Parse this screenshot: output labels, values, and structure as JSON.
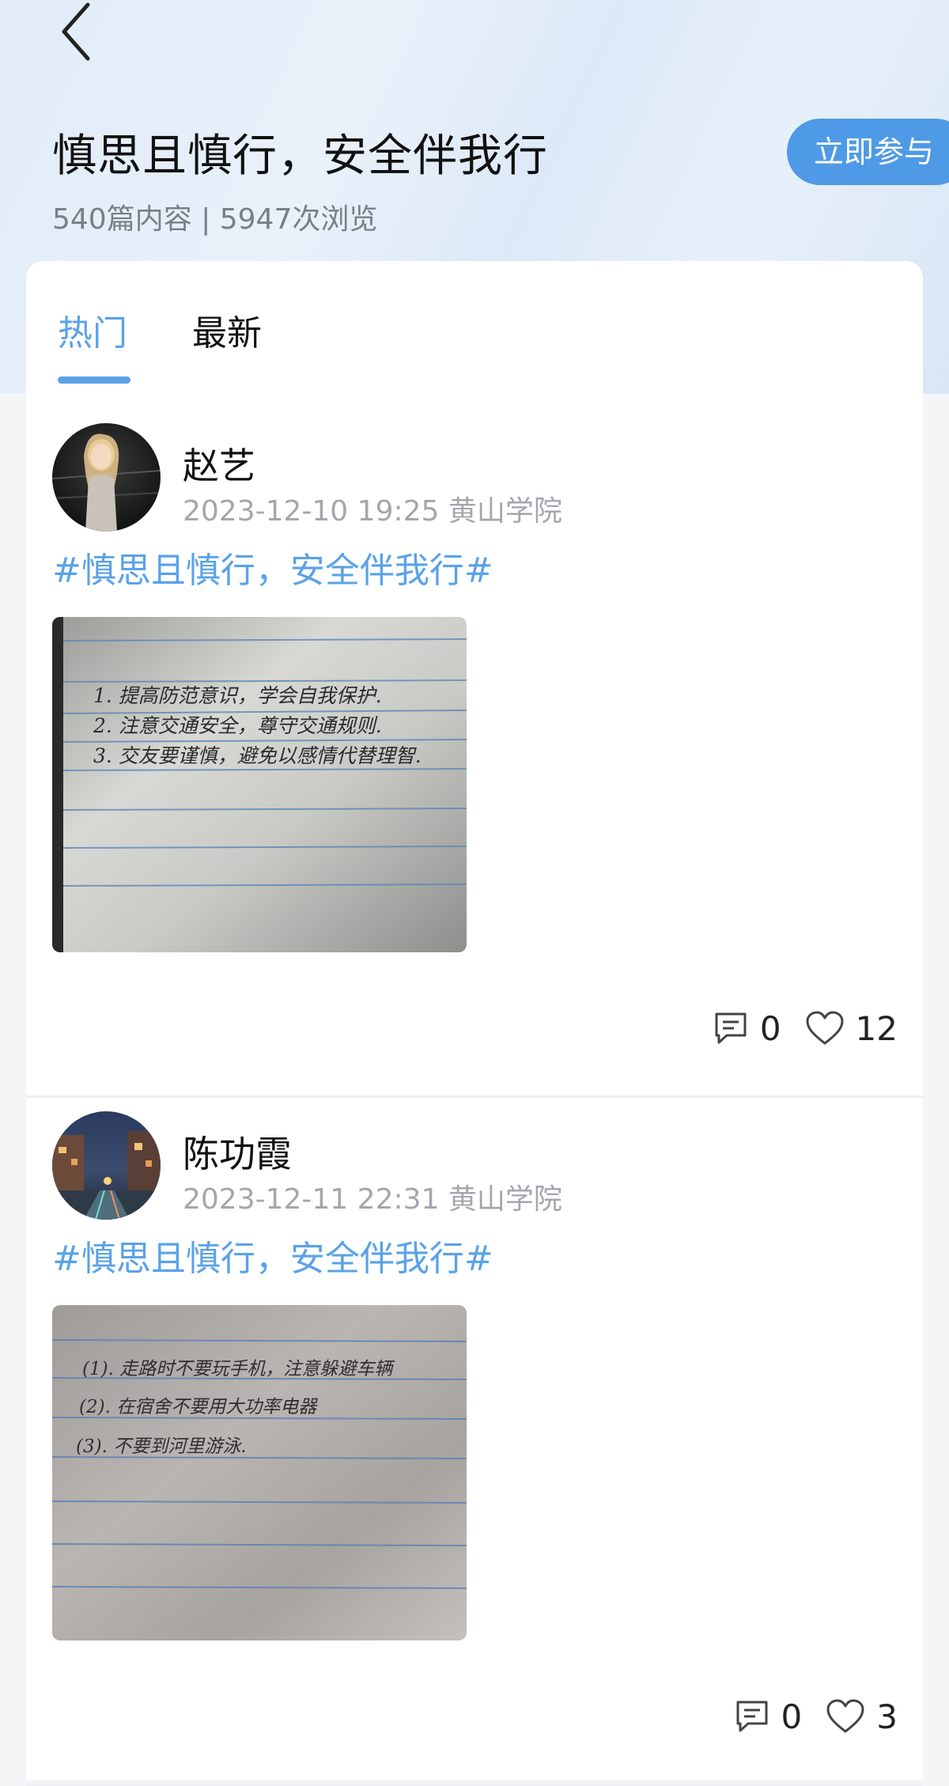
{
  "header": {
    "title": "慎思且慎行，安全伴我行",
    "stats": "540篇内容 | 5947次浏览",
    "join_label": "立即参与",
    "back_icon": "chevron-left-icon"
  },
  "tabs": [
    {
      "label": "热门",
      "active": true
    },
    {
      "label": "最新",
      "active": false
    }
  ],
  "colors": {
    "accent": "#5aa2e8",
    "join_button": "#4f9ae6",
    "meta_text": "#a3a7ad"
  },
  "posts": [
    {
      "author": "赵艺",
      "meta": "2023-12-10 19:25 黄山学院",
      "hashtag": "#慎思且慎行，安全伴我行#",
      "image_lines": [
        "1. 提高防范意识，学会自我保护.",
        "2. 注意交通安全，尊守交通规则.",
        "3. 交友要谨慎，避免以感情代替理智."
      ],
      "comments": "0",
      "likes": "12"
    },
    {
      "author": "陈功霞",
      "meta": "2023-12-11 22:31 黄山学院",
      "hashtag": "#慎思且慎行，安全伴我行#",
      "image_lines": [
        "(1). 走路时不要玩手机，注意躲避车辆",
        "(2). 在宿舍不要用大功率电器",
        "(3). 不要到河里游泳."
      ],
      "comments": "0",
      "likes": "3"
    }
  ]
}
